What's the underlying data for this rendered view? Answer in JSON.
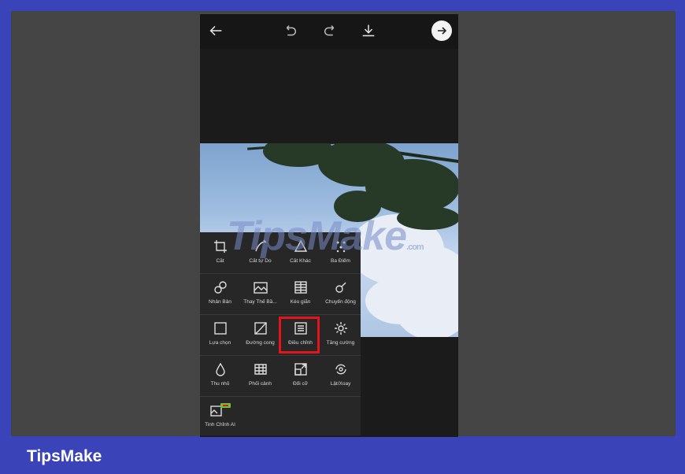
{
  "brand": "TipsMake",
  "watermark": {
    "main": "TipsMake",
    "suffix": ".com"
  },
  "toolbar": {
    "icons": [
      "back-arrow-icon",
      "undo-icon",
      "redo-icon",
      "download-icon",
      "next-arrow-icon"
    ]
  },
  "tools": [
    {
      "label": "Cắt",
      "icon": "crop-icon"
    },
    {
      "label": "Cắt tự Do",
      "icon": "freecrop-icon"
    },
    {
      "label": "Cắt Khác",
      "icon": "shape-crop-icon"
    },
    {
      "label": "Ba Điểm",
      "icon": "dots-icon"
    },
    {
      "label": "Nhân Bản",
      "icon": "clone-icon"
    },
    {
      "label": "Thay Thế Bầ...",
      "icon": "replace-sky-icon"
    },
    {
      "label": "Kéo giãn",
      "icon": "stretch-icon"
    },
    {
      "label": "Chuyển động",
      "icon": "motion-icon"
    },
    {
      "label": "Lựa chọn",
      "icon": "selection-icon"
    },
    {
      "label": "Đường cong",
      "icon": "curves-icon"
    },
    {
      "label": "Điều chỉnh",
      "icon": "adjust-icon"
    },
    {
      "label": "Tăng cường",
      "icon": "enhance-icon"
    },
    {
      "label": "Thu nhỏ",
      "icon": "drop-icon"
    },
    {
      "label": "Phối cảnh",
      "icon": "perspective-icon"
    },
    {
      "label": "Đổi cỡ",
      "icon": "resize-icon"
    },
    {
      "label": "Lật/Xoay",
      "icon": "flip-rotate-icon"
    },
    {
      "label": "Tinh Chỉnh AI",
      "icon": "ai-enhance-icon",
      "badge": "NEW"
    }
  ],
  "colors": {
    "frame_border": "#3a44b8",
    "highlight": "#e4141c",
    "panel": "#272727"
  }
}
